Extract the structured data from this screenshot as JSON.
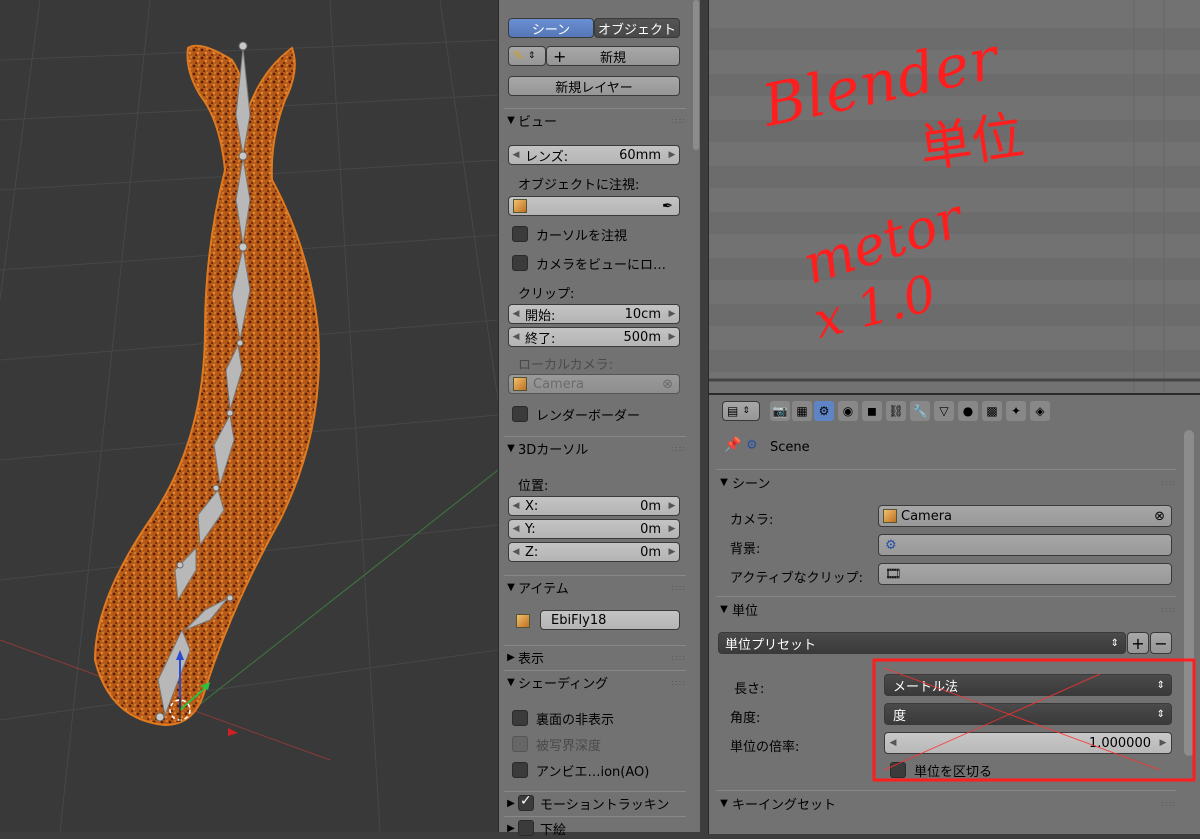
{
  "npanel": {
    "tab_scene": "シーン",
    "tab_object": "オブジェクト",
    "new_label": "新規",
    "new_layer": "新規レイヤー",
    "view": {
      "header": "ビュー",
      "lens_label": "レンズ:",
      "lens_value": "60mm",
      "lock_object_label": "オブジェクトに注視:",
      "lock_cursor": "カーソルを注視",
      "lock_camera": "カメラをビューにロ…",
      "clip_label": "クリップ:",
      "clip_start_label": "開始:",
      "clip_start_value": "10cm",
      "clip_end_label": "終了:",
      "clip_end_value": "500m",
      "local_camera_label": "ローカルカメラ:",
      "local_camera_value": "Camera",
      "render_border": "レンダーボーダー"
    },
    "cursor": {
      "header": "3Dカーソル",
      "location_label": "位置:",
      "x_label": "X:",
      "x_value": "0m",
      "y_label": "Y:",
      "y_value": "0m",
      "z_label": "Z:",
      "z_value": "0m"
    },
    "item": {
      "header": "アイテム",
      "name": "EbiFly18"
    },
    "display_header": "表示",
    "shading": {
      "header": "シェーディング",
      "backface": "裏面の非表示",
      "dof": "被写界深度",
      "ao": "アンビエ…ion(AO)"
    },
    "motion_tracking": "モーショントラッキン",
    "background_header": "下絵"
  },
  "annotation": {
    "line1": "Blender",
    "line2": "単位",
    "line3": "metor",
    "line4": "x 1.0"
  },
  "properties": {
    "breadcrumb": "Scene",
    "scene_panel": {
      "header": "シーン",
      "camera_label": "カメラ:",
      "camera_value": "Camera",
      "background_label": "背景:",
      "active_clip_label": "アクティブなクリップ:"
    },
    "units_panel": {
      "header": "単位",
      "preset": "単位プリセット",
      "length_label": "長さ:",
      "length_value": "メートル法",
      "rotation_label": "角度:",
      "rotation_value": "度",
      "scale_label": "単位の倍率:",
      "scale_value": "1.000000",
      "separate_units": "単位を区切る"
    },
    "keying_header": "キーイングセット"
  },
  "colors": {
    "panel_bg": "#727272",
    "viewport_bg": "#393939",
    "selected_tab": "#5f84c6",
    "annotation_red": "#ff1e1e",
    "mesh_orange": "#c8641e"
  }
}
